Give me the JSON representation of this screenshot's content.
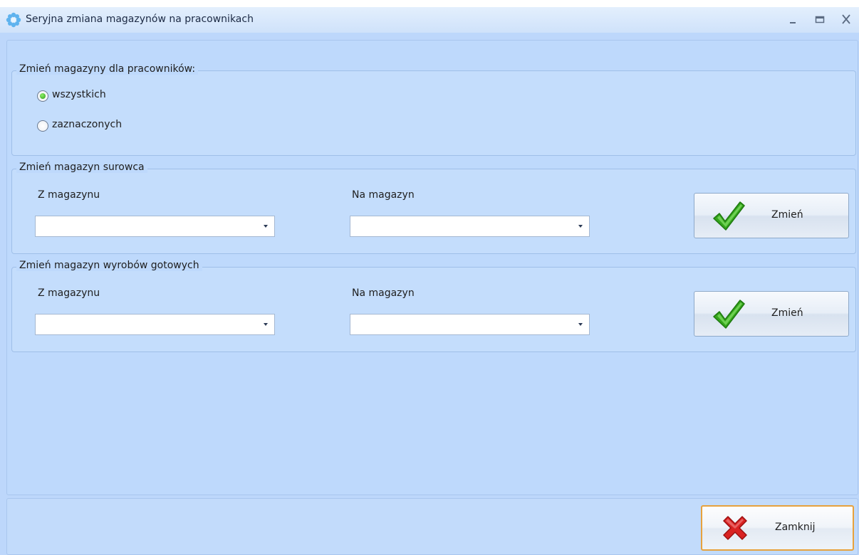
{
  "window": {
    "title": "Seryjna zmiana magazynów na pracownikach",
    "app_icon": "flower-app-icon",
    "controls": {
      "minimize": "minimize-icon",
      "maximize": "maximize-icon",
      "close": "close-icon"
    }
  },
  "employees_group": {
    "legend": "Zmień magazyny dla pracowników:",
    "options": [
      {
        "label": "wszystkich",
        "checked": true
      },
      {
        "label": "zaznaczonych",
        "checked": false
      }
    ]
  },
  "raw_material_group": {
    "legend": "Zmień magazyn surowca",
    "from_label": "Z magazynu",
    "from_value": "",
    "to_label": "Na magazyn",
    "to_value": "",
    "button_label": "Zmień",
    "button_icon": "green-checkmark-icon"
  },
  "finished_goods_group": {
    "legend": "Zmień magazyn wyrobów gotowych",
    "from_label": "Z magazynu",
    "from_value": "",
    "to_label": "Na magazyn",
    "to_value": "",
    "button_label": "Zmień",
    "button_icon": "green-checkmark-icon"
  },
  "footer": {
    "close_label": "Zamknij",
    "close_icon": "red-x-icon"
  },
  "colors": {
    "window_background": "#bdd7fb",
    "titlebar": "#cfe2fa",
    "close_button_border": "#e7a23d",
    "check_green": "#34a51c",
    "x_red": "#d92222"
  }
}
